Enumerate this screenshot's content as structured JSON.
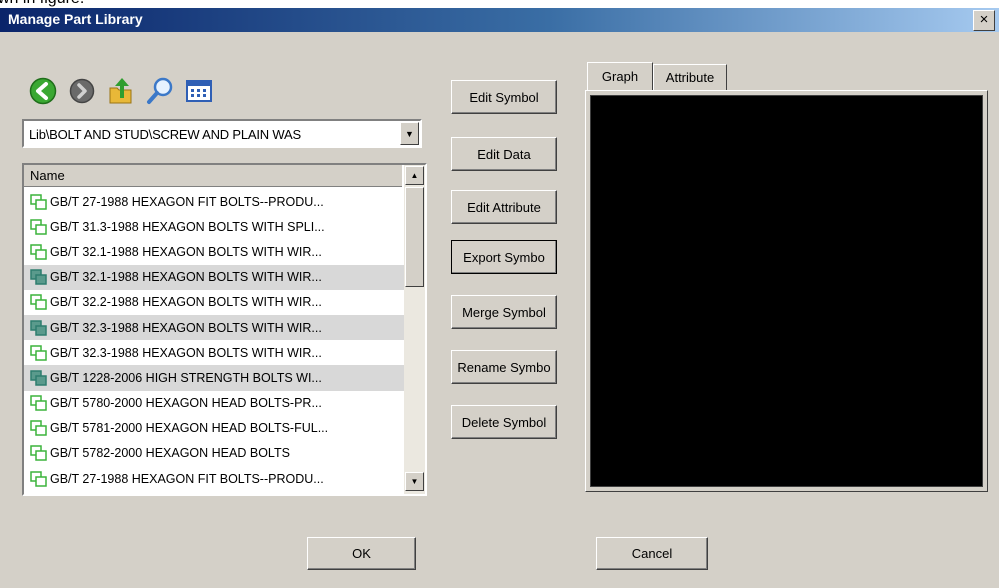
{
  "top_caption": "wn in figure.",
  "window": {
    "title": "Manage Part Library",
    "close_glyph": "×"
  },
  "toolbar": {
    "icons": [
      "back-icon",
      "forward-icon",
      "up-folder-icon",
      "search-icon",
      "view-mode-icon"
    ]
  },
  "path_combo": {
    "value": "Lib\\BOLT AND STUD\\SCREW AND PLAIN WAS"
  },
  "list": {
    "header": "Name",
    "rows": [
      "GB/T 27-1988 HEXAGON FIT BOLTS--PRODU...",
      "GB/T 31.3-1988 HEXAGON BOLTS WITH SPLI...",
      "GB/T 32.1-1988 HEXAGON BOLTS WITH WIR...",
      "GB/T 32.1-1988 HEXAGON BOLTS WITH WIR...",
      "GB/T 32.2-1988 HEXAGON BOLTS WITH WIR...",
      "GB/T 32.3-1988 HEXAGON BOLTS WITH WIR...",
      "GB/T 32.3-1988 HEXAGON BOLTS WITH WIR...",
      "GB/T 1228-2006 HIGH STRENGTH BOLTS WI...",
      "GB/T 5780-2000 HEXAGON HEAD BOLTS-PR...",
      "GB/T 5781-2000 HEXAGON HEAD BOLTS-FUL...",
      "GB/T 5782-2000 HEXAGON HEAD BOLTS",
      "GB/T 27-1988 HEXAGON FIT BOLTS--PRODU..."
    ]
  },
  "actions": {
    "edit_symbol": "Edit Symbol",
    "edit_data": "Edit Data",
    "edit_attribute": "Edit Attribute",
    "export_symbol": "Export Symbo",
    "merge_symbol": "Merge Symbol",
    "rename_symbol": "Rename Symbo",
    "delete_symbol": "Delete Symbol"
  },
  "tabs": {
    "graph": "Graph",
    "attribute": "Attribute"
  },
  "footer": {
    "ok": "OK",
    "cancel": "Cancel"
  },
  "colors": {
    "title_bar_start": "#0a246a",
    "title_bar_end": "#a6caf0",
    "dialog_bg": "#d4d0c8",
    "preview_bg": "#000000",
    "row_icon": "#3cb43c",
    "row_icon_dark": "#2e7d6e"
  }
}
